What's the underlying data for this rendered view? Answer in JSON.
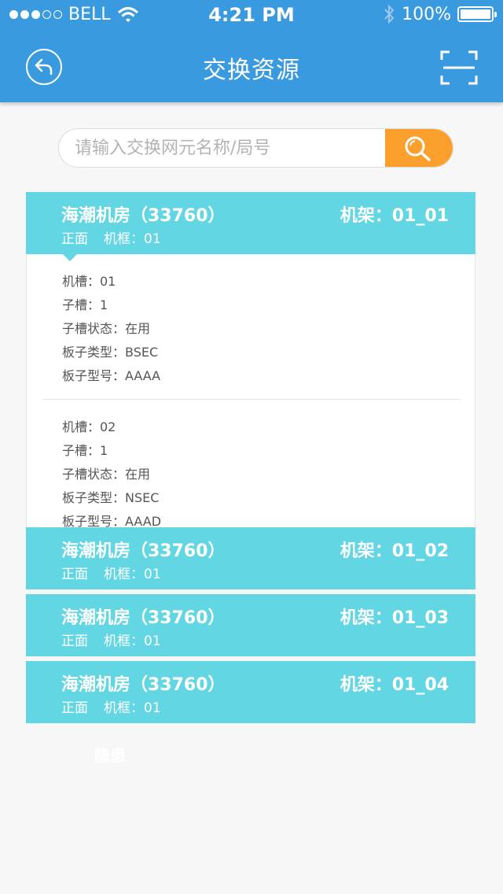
{
  "status_bar": {
    "carrier": "BELL",
    "time": "4:21 PM",
    "battery": "100%"
  },
  "nav": {
    "title": "交换资源",
    "back_icon": "back-arrow-icon",
    "scan_icon": "scan-icon"
  },
  "search": {
    "placeholder": "请输入交换网元名称/局号",
    "button_icon": "search-icon"
  },
  "racks": [
    {
      "room": "海潮机房（33760）",
      "rack": "机架：01_01",
      "side": "正面",
      "frame": "机框：01",
      "expanded": true,
      "slots": [
        {
          "slot": "机槽：01",
          "subslot": "子槽：1",
          "status": "子槽状态：在用",
          "board_type": "板子类型：BSEC",
          "board_model": "板子型号：AAAA"
        },
        {
          "slot": "机槽：02",
          "subslot": "子槽：1",
          "status": "子槽状态：在用",
          "board_type": "板子类型：NSEC",
          "board_model": "板子型号：AAAD"
        }
      ]
    },
    {
      "room": "海潮机房（33760）",
      "rack": "机架：01_02",
      "side": "正面",
      "frame": "机框：01"
    },
    {
      "room": "海潮机房（33760）",
      "rack": "机架：01_03",
      "side": "正面",
      "frame": "机框：01"
    },
    {
      "room": "海潮机房（33760）",
      "rack": "机架：01_04",
      "side": "正面",
      "frame": "机框：01"
    }
  ],
  "footer": {
    "text": "隐患"
  },
  "colors": {
    "header": "#3a9ae0",
    "card_header": "#63d6e3",
    "search_button": "#fba02c"
  }
}
